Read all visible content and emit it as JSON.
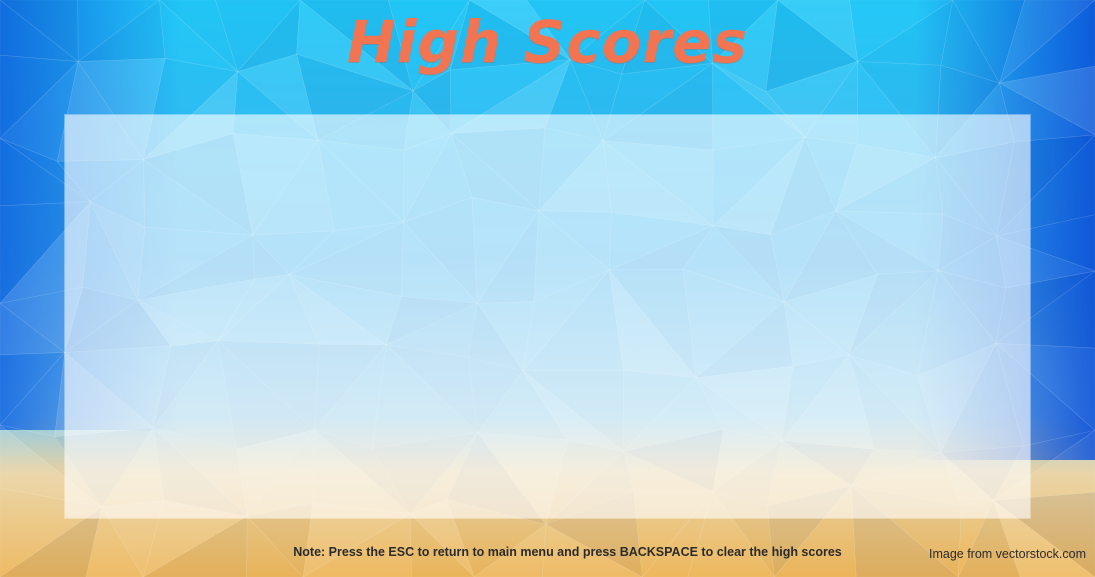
{
  "screen": {
    "title": "High Scores",
    "note": "Note: Press the ESC to return to main menu and press BACKSPACE to clear the high scores",
    "image_credit": "Image from vectorstock.com",
    "scores": []
  },
  "colors": {
    "title": "#F27451",
    "sky_top": "#17C2F5",
    "sky_edge": "#1473E6",
    "sand": "#EEB85A",
    "text": "#2B2B2B"
  }
}
